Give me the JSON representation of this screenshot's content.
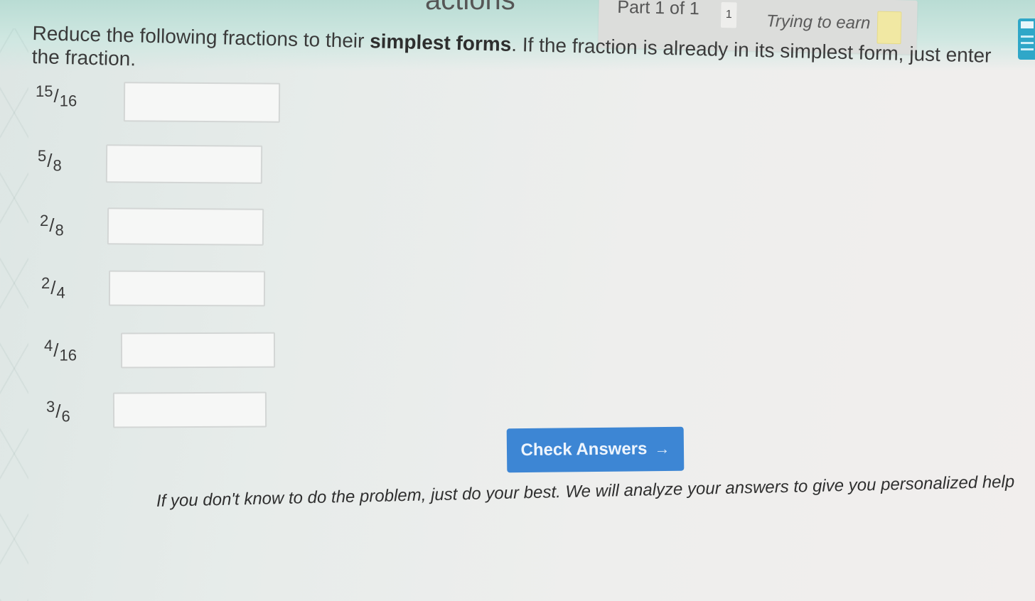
{
  "header": {
    "title_fragment": "actions",
    "part_label": "Part 1 of 1",
    "badge_count": "1",
    "earn_label": "Trying to earn"
  },
  "instructions": {
    "before": "Reduce the following fractions to their ",
    "bold": "simplest forms",
    "after": ". If the fraction is already in its simplest form, just enter the fraction."
  },
  "problems": [
    {
      "numerator": "15",
      "denominator": "16",
      "answer": ""
    },
    {
      "numerator": "5",
      "denominator": "8",
      "answer": ""
    },
    {
      "numerator": "2",
      "denominator": "8",
      "answer": ""
    },
    {
      "numerator": "2",
      "denominator": "4",
      "answer": ""
    },
    {
      "numerator": "4",
      "denominator": "16",
      "answer": ""
    },
    {
      "numerator": "3",
      "denominator": "6",
      "answer": ""
    }
  ],
  "check_button": {
    "label": "Check Answers",
    "icon": "arrow-right-icon"
  },
  "help_text": "If you don't know to do the problem, just do your best. We will analyze your answers to give you personalized help",
  "colors": {
    "accent": "#3d86d4",
    "header_band": "#b9dcd4"
  }
}
